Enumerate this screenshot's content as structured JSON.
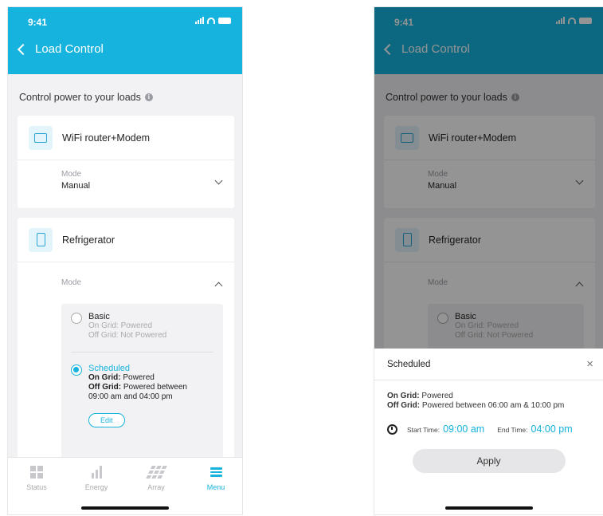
{
  "status": {
    "time": "9:41"
  },
  "header": {
    "title": "Load Control"
  },
  "section": {
    "label": "Control power to your loads",
    "info": "i"
  },
  "devices": [
    {
      "name": "WiFi router+Modem",
      "mode_label": "Mode",
      "mode_value": "Manual"
    },
    {
      "name": "Refrigerator",
      "mode_label": "Mode"
    }
  ],
  "options": {
    "basic": {
      "title": "Basic",
      "on_grid": "On Grid: Powered",
      "off_grid": "Off Grid: Not Powered"
    },
    "scheduled": {
      "title": "Scheduled",
      "on_grid_label": "On Grid:",
      "on_grid_value": "Powered",
      "off_grid_label": "Off Grid:",
      "off_grid_value": "Powered between",
      "off_grid_times": "09:00 am and 04:00 pm",
      "edit": "Edit"
    }
  },
  "tabs": [
    {
      "label": "Status",
      "icon": "grid-icon"
    },
    {
      "label": "Energy",
      "icon": "bar-chart-icon"
    },
    {
      "label": "Array",
      "icon": "solar-panel-icon"
    },
    {
      "label": "Menu",
      "icon": "menu-icon",
      "active": true
    }
  ],
  "sheet": {
    "title": "Scheduled",
    "close": "×",
    "on_grid_label": "On Grid:",
    "on_grid_value": "Powered",
    "off_grid_label": "Off Grid:",
    "off_grid_value": "Powered between 06:00 am & 10:00 pm",
    "start_label": "Start Time:",
    "start_value": "09:00 am",
    "end_label": "End Time:",
    "end_value": "04:00 pm",
    "apply": "Apply"
  },
  "colors": {
    "accent": "#15b3dd",
    "header": "#15b3dd"
  }
}
